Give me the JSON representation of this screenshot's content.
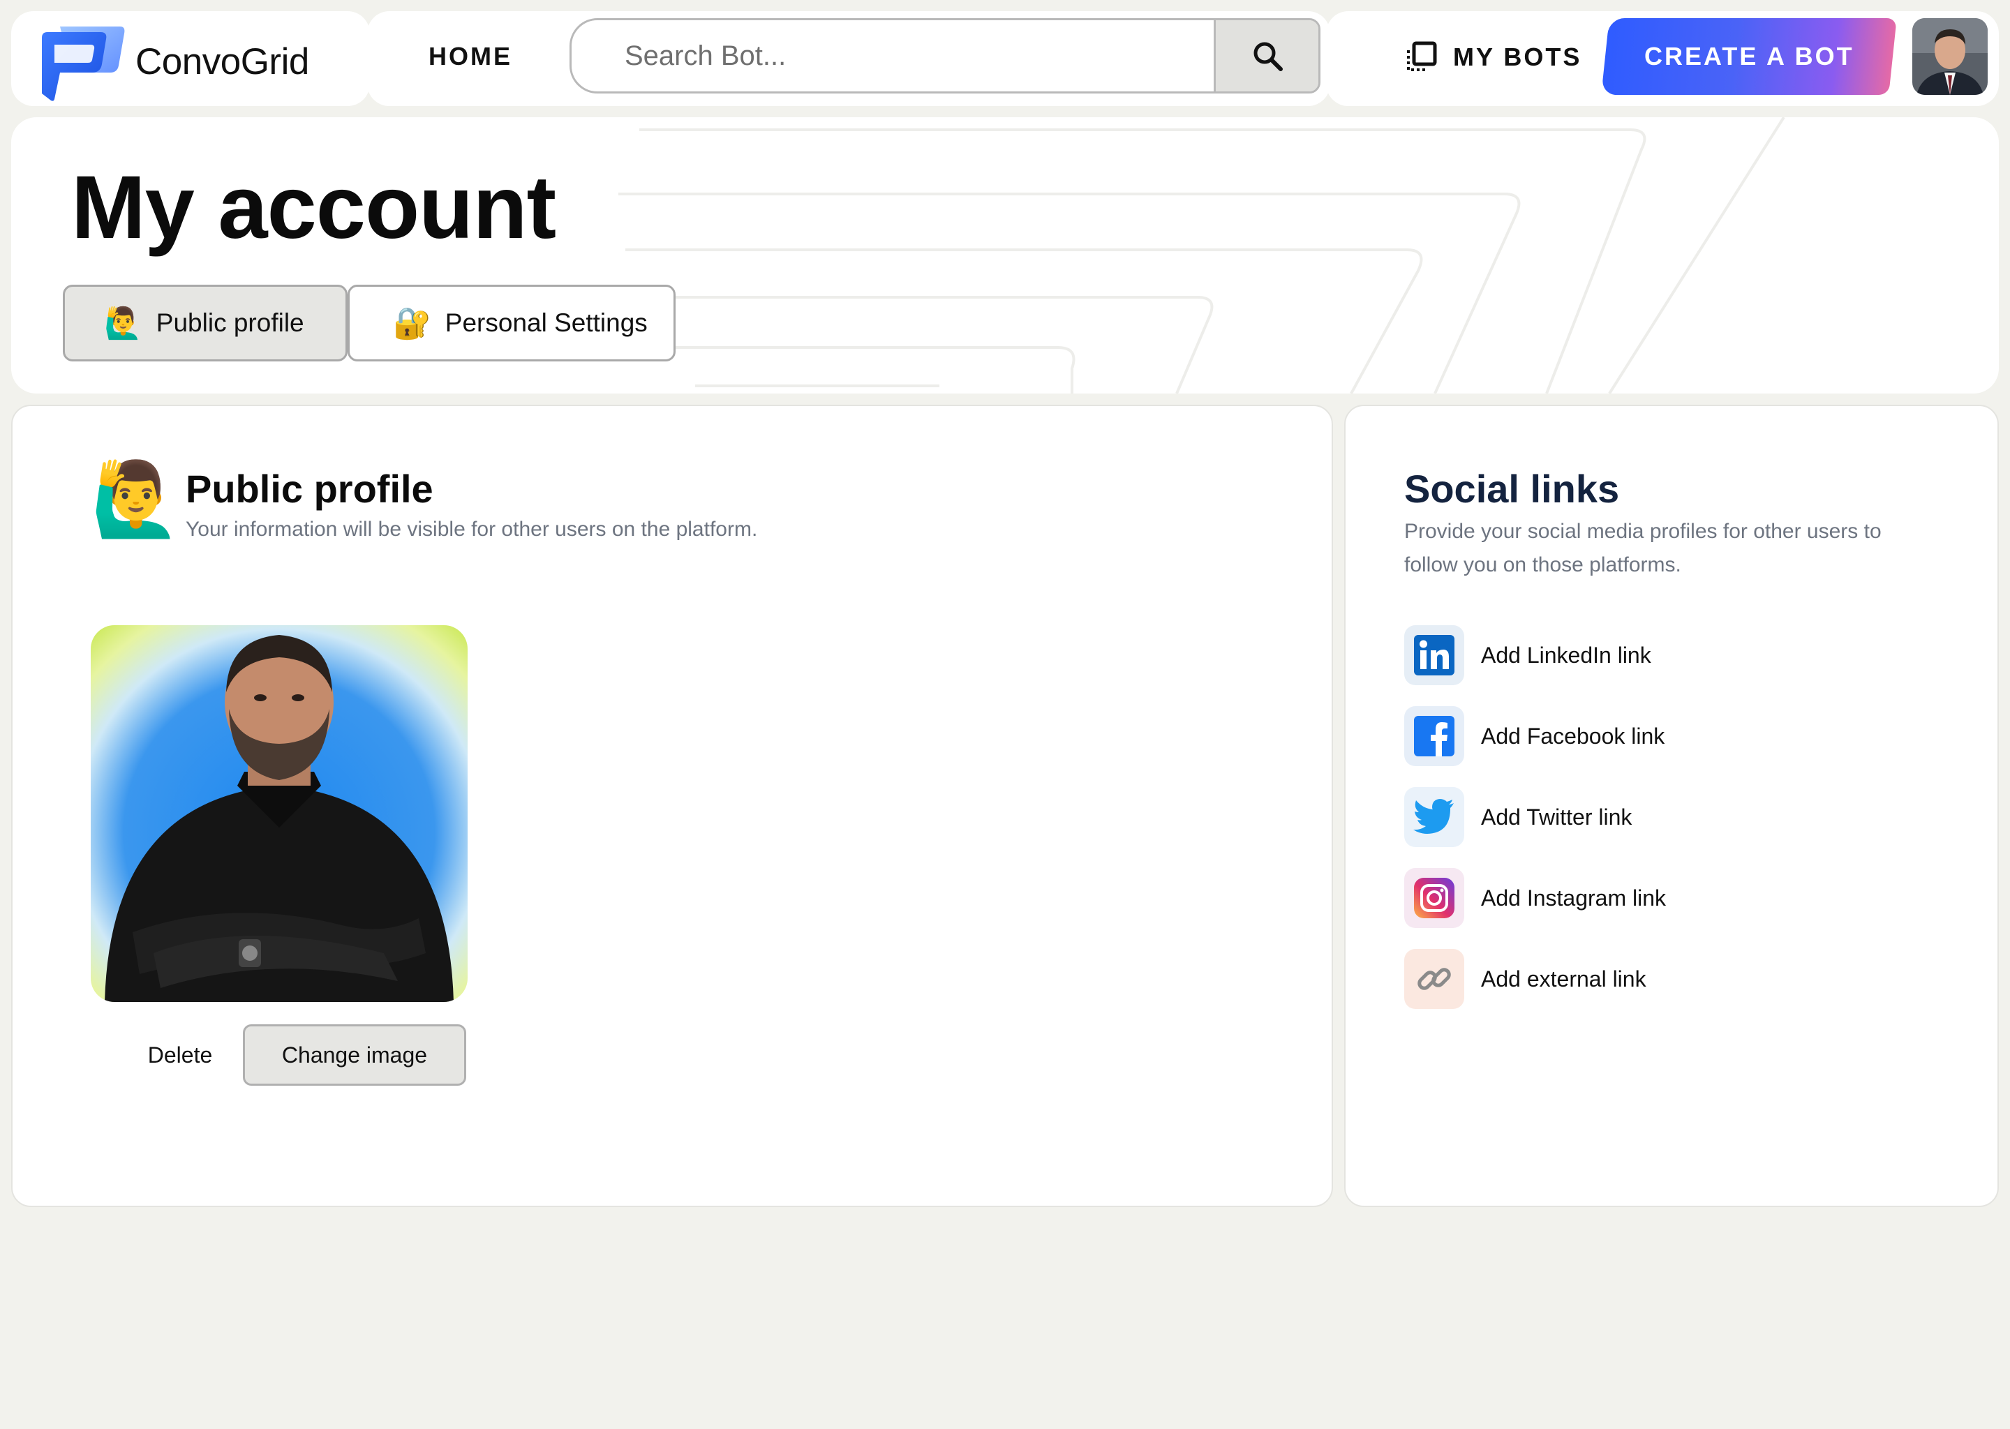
{
  "app": {
    "name": "ConvoGrid"
  },
  "nav": {
    "home_label": "HOME",
    "search_placeholder": "Search Bot...",
    "my_bots_label": "MY BOTS",
    "create_label": "CREATE A BOT",
    "create_gradient": [
      "#2f5cff",
      "#8a5cf0",
      "#e56aa6"
    ]
  },
  "header": {
    "title": "My account",
    "tabs": [
      {
        "label": "Public profile",
        "icon": "raising-hand-emoji",
        "active": true
      },
      {
        "label": "Personal Settings",
        "icon": "lock-key-emoji",
        "active": false
      }
    ]
  },
  "profile": {
    "title": "Public profile",
    "subtitle": "Your information will be visible for other users on the platform.",
    "delete_label": "Delete",
    "change_label": "Change image"
  },
  "social": {
    "title": "Social links",
    "subtitle": "Provide your social media profiles for other users to follow you on those platforms.",
    "links": [
      {
        "label": "Add LinkedIn link",
        "icon": "linkedin-icon",
        "color": "#0a66c2"
      },
      {
        "label": "Add Facebook link",
        "icon": "facebook-icon",
        "color": "#1877f2"
      },
      {
        "label": "Add Twitter link",
        "icon": "twitter-icon",
        "color": "#1d9bf0"
      },
      {
        "label": "Add Instagram link",
        "icon": "instagram-icon",
        "color": "#d6249f"
      },
      {
        "label": "Add external link",
        "icon": "link-icon",
        "color": "#8a8a8a"
      }
    ]
  }
}
